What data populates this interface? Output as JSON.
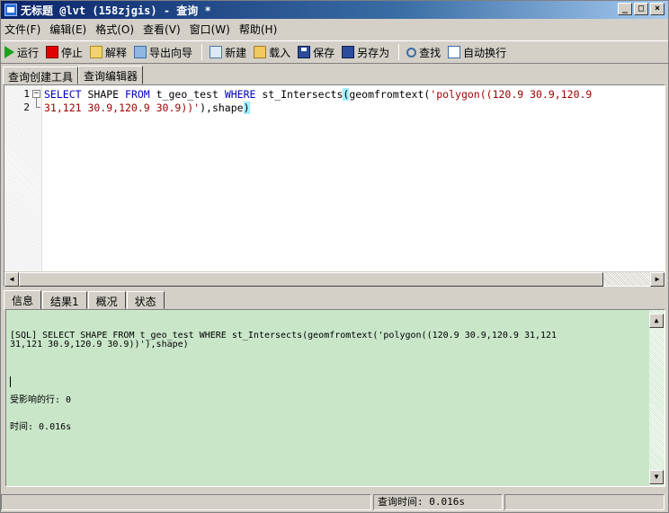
{
  "window": {
    "title": "无标题 @lvt (158zjgis) - 查询 *",
    "buttons": {
      "minimize": "_",
      "maximize": "□",
      "close": "×"
    }
  },
  "menu": [
    "文件(F)",
    "编辑(E)",
    "格式(O)",
    "查看(V)",
    "窗口(W)",
    "帮助(H)"
  ],
  "toolbar": {
    "run": "运行",
    "stop": "停止",
    "explain": "解释",
    "export": "导出向导",
    "new": "新建",
    "load": "载入",
    "save": "保存",
    "saveas": "另存为",
    "find": "查找",
    "wrap": "自动换行"
  },
  "top_tabs": [
    "查询创建工具",
    "查询编辑器"
  ],
  "editor": {
    "line_numbers": [
      "1",
      "2"
    ],
    "fold_symbol": "−"
  },
  "bottom_tabs": [
    "信息",
    "结果1",
    "概况",
    "状态"
  ],
  "messages": {
    "sql": "[SQL] SELECT SHAPE FROM t_geo_test WHERE st_Intersects(geomfromtext('polygon((120.9 30.9,120.9 31,121\n31,121 30.9,120.9 30.9))'),shape)",
    "affected": "受影响的行: 0",
    "time": "时间: 0.016s"
  },
  "statusbar": {
    "query_time": "查询时间: 0.016s"
  },
  "colors": {
    "title_gradient_start": "#0a246a",
    "keyword": "#0000c0",
    "string": "#a00000",
    "bracket_highlight": "#9ff0ff",
    "message_bg": "#c9e6c9"
  }
}
